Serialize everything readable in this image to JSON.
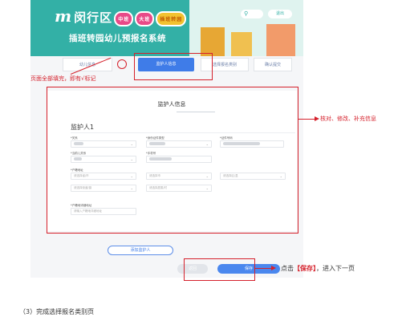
{
  "header": {
    "brand_mark": "m",
    "brand_title": "闵行区",
    "badge_mid": "中班",
    "badge_big": "大班",
    "badge_note": "插班转园",
    "subtitle": "插班转园幼儿预报名系统",
    "user_label": "",
    "logout_label": "退出"
  },
  "steps": [
    "幼儿信息",
    "监护人信息",
    "选择报名类别",
    "确认提交"
  ],
  "form": {
    "title": "监护人信息",
    "guardian_name": "监护人1",
    "fields": {
      "relation_label": "*关系",
      "id_type_label": "*身份证件类型",
      "id_no_label": "*证件号码",
      "birth_label": "*当前儿关系",
      "phone_label": "*手机号",
      "household_label": "*户籍地址",
      "province_placeholder": "请选择省/市",
      "city_placeholder": "请选择市",
      "district_placeholder": "请选择区/县",
      "street_placeholder": "请选择街道/镇",
      "village_placeholder": "请选择居委/村",
      "address_detail_label": "*户籍地详细地址",
      "address_detail_placeholder": "请输入户籍地详细地址"
    }
  },
  "buttons": {
    "add_guardian": "添加监护人",
    "back": "返回",
    "save": "保存"
  },
  "annotations": {
    "fill_all": "页面全部填完，即有√标记",
    "verify": "核对、修改、补充信息",
    "click_save_prefix": "点击",
    "click_save_bold": "【保存】",
    "click_save_suffix": "，进入下一页",
    "section_heading": "（3）完成选择报名类别页"
  },
  "colors": {
    "banner": "#33b0a6",
    "primary": "#3f7ce8",
    "annotation_red": "#d5202b"
  }
}
